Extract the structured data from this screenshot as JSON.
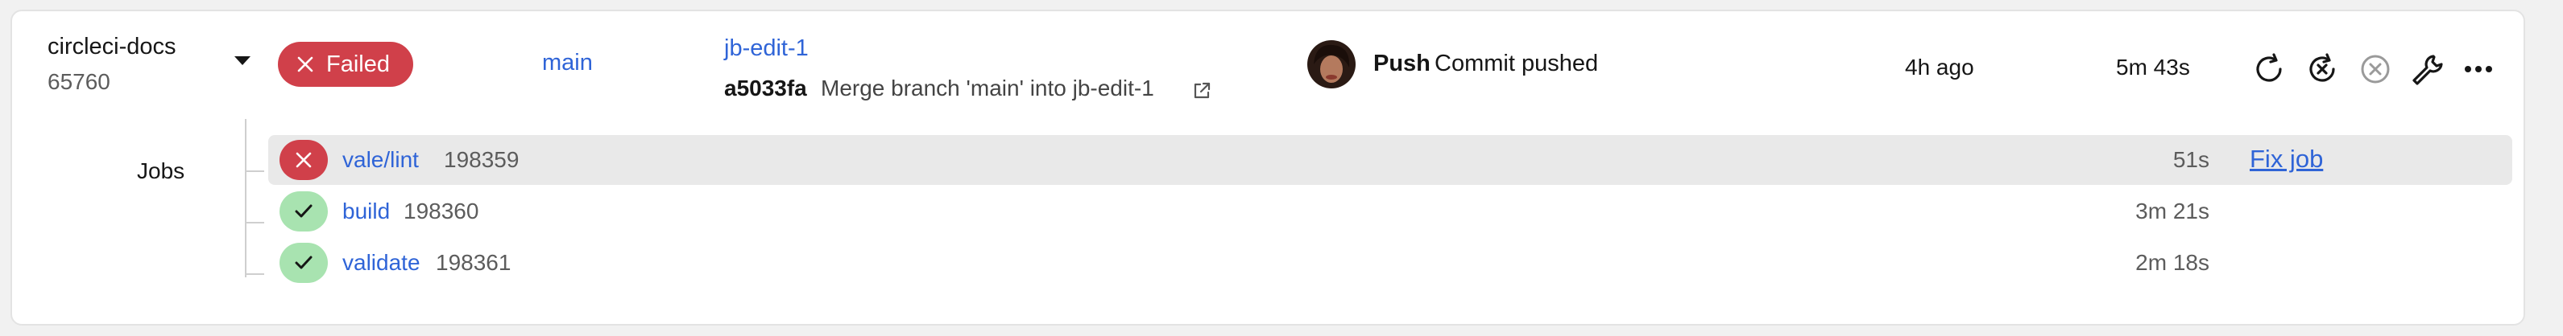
{
  "pipeline": {
    "project": "circleci-docs",
    "number": "65760",
    "status": "Failed",
    "branch": "main",
    "workflow": "jb-edit-1",
    "commit_sha": "a5033fa",
    "commit_message": "Merge branch 'main' into jb-edit-1",
    "trigger_type": "Push",
    "trigger_text": "Commit pushed",
    "started": "4h ago",
    "duration": "5m 43s",
    "actions": [
      "rerun-icon",
      "rerun-failed-icon",
      "cancel-icon",
      "wrench-icon",
      "more-icon"
    ]
  },
  "jobs_label": "Jobs",
  "jobs": [
    {
      "name": "vale/lint",
      "number": "198359",
      "duration": "51s",
      "status": "failed",
      "action": "Fix job"
    },
    {
      "name": "build",
      "number": "198360",
      "duration": "3m 21s",
      "status": "success"
    },
    {
      "name": "validate",
      "number": "198361",
      "duration": "2m 18s",
      "status": "success"
    }
  ],
  "colors": {
    "failed": "#d0404a",
    "success_bg": "#a8e3b0",
    "link": "#2f64d7"
  }
}
